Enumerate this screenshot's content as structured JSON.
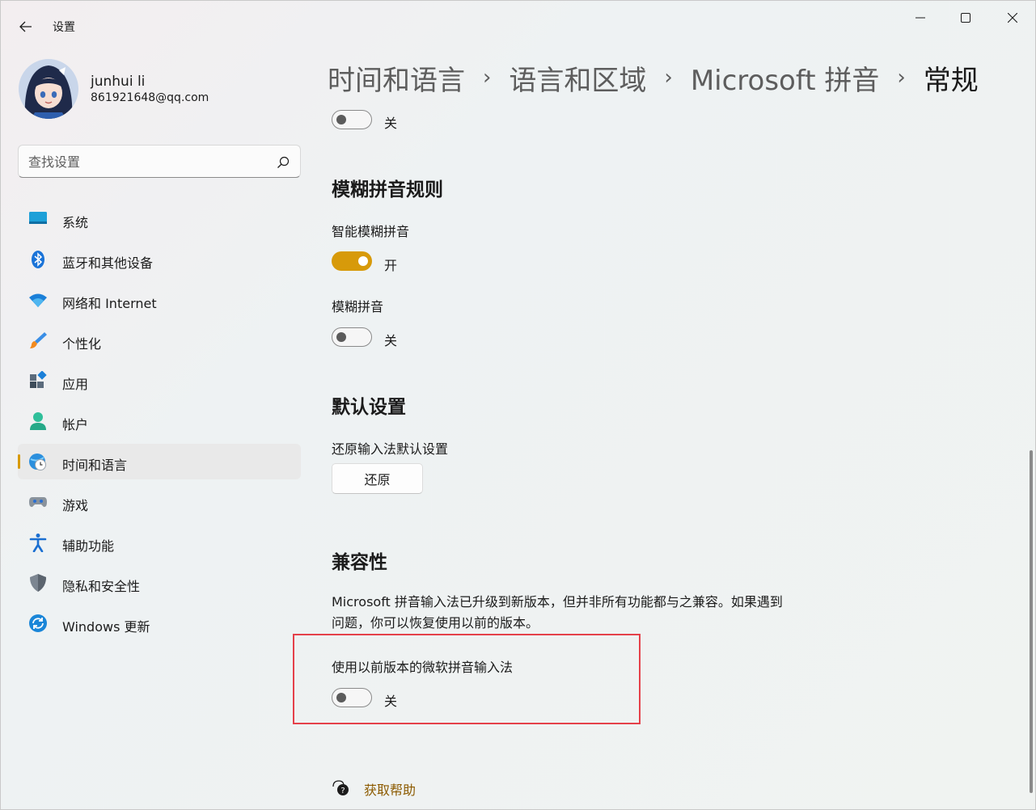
{
  "window": {
    "title": "设置"
  },
  "profile": {
    "name": "junhui li",
    "email": "861921648@qq.com"
  },
  "search": {
    "placeholder": "查找设置",
    "value": ""
  },
  "nav": {
    "items": [
      {
        "label": "系统",
        "icon": "system-icon"
      },
      {
        "label": "蓝牙和其他设备",
        "icon": "bluetooth-icon"
      },
      {
        "label": "网络和 Internet",
        "icon": "wifi-icon"
      },
      {
        "label": "个性化",
        "icon": "brush-icon"
      },
      {
        "label": "应用",
        "icon": "apps-icon"
      },
      {
        "label": "帐户",
        "icon": "account-icon"
      },
      {
        "label": "时间和语言",
        "icon": "time-language-icon",
        "active": true
      },
      {
        "label": "游戏",
        "icon": "gamepad-icon"
      },
      {
        "label": "辅助功能",
        "icon": "accessibility-icon"
      },
      {
        "label": "隐私和安全性",
        "icon": "shield-icon"
      },
      {
        "label": "Windows 更新",
        "icon": "update-icon"
      }
    ]
  },
  "breadcrumb": [
    "时间和语言",
    "语言和区域",
    "Microsoft 拼音",
    "常规"
  ],
  "content": {
    "top_toggle": {
      "state": "关",
      "on": false
    },
    "fuzzy": {
      "title": "模糊拼音规则",
      "smart_label": "智能模糊拼音",
      "smart_state": "开",
      "fuzzy_label": "模糊拼音",
      "fuzzy_state": "关"
    },
    "defaults": {
      "title": "默认设置",
      "reset_label": "还原输入法默认设置",
      "reset_button": "还原"
    },
    "compat": {
      "title": "兼容性",
      "description": "Microsoft 拼音输入法已升级到新版本，但并非所有功能都与之兼容。如果遇到问题，你可以恢复使用以前的版本。",
      "legacy_label": "使用以前版本的微软拼音输入法",
      "legacy_state": "关"
    },
    "help": {
      "label": "获取帮助"
    }
  },
  "colors": {
    "accent": "#d79a0a",
    "highlight": "#e5414a",
    "link": "#8c5a00"
  }
}
